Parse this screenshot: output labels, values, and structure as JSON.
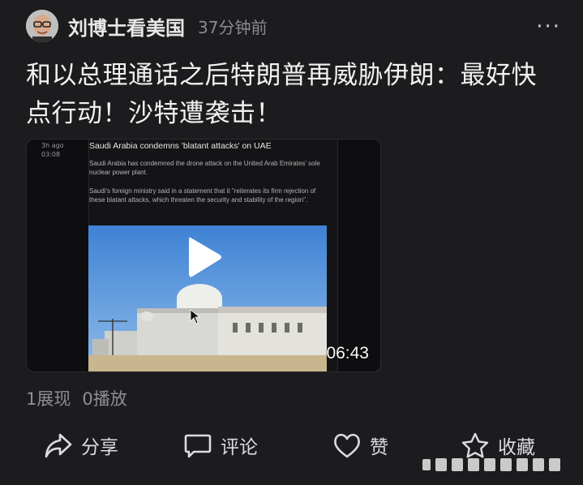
{
  "post": {
    "author": "刘博士看美国",
    "time": "37分钟前",
    "title": "和以总理通话之后特朗普再威胁伊朗：最好快点行动！沙特遭袭击！"
  },
  "video": {
    "meta_ago": "3h ago",
    "meta_time": "03:08",
    "headline": "Saudi Arabia condemns 'blatant attacks' on UAE",
    "paragraph1": "Saudi Arabia has condemned the drone attack on the United Arab Emirates' sole nuclear power plant.",
    "paragraph2": "Saudi's foreign ministry said in a statement that it \"reiterates its firm rejection of these blatant attacks, which threaten the security and stability of the region\".",
    "duration": "06:43"
  },
  "stats": {
    "views": "1展现",
    "plays": "0播放"
  },
  "actions": {
    "share": "分享",
    "comment": "评论",
    "like": "赞",
    "favorite": "收藏"
  }
}
